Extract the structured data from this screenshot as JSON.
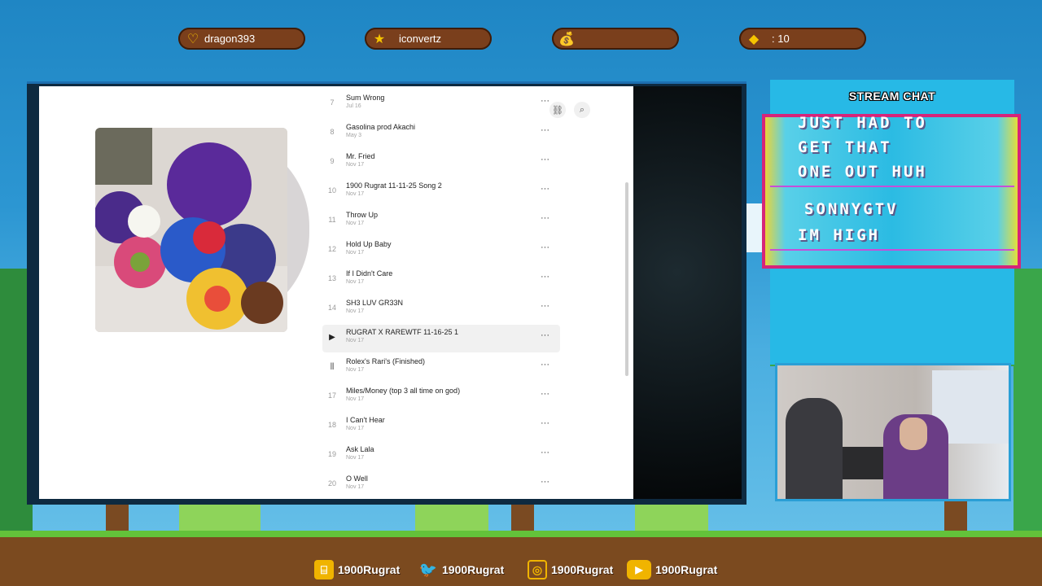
{
  "stats": [
    {
      "icon": "heart-icon",
      "glyph": "♡",
      "label": "dragon393"
    },
    {
      "icon": "star-icon",
      "glyph": "★",
      "label": "iconvertz"
    },
    {
      "icon": "money-bag-icon",
      "glyph": "💰",
      "label": ""
    },
    {
      "icon": "gem-icon",
      "glyph": "◆",
      "label": ": 10"
    }
  ],
  "chat": {
    "title": "STREAM CHAT",
    "lines": [
      "JUST HAD TO",
      "GET THAT",
      "ONE OUT HUH",
      "SONNYGTV",
      "IM HIGH"
    ]
  },
  "tracks": [
    {
      "num": "7",
      "title": "Sum Wrong",
      "date": "Jul 16"
    },
    {
      "num": "8",
      "title": "Gasolina prod Akachi",
      "date": "May 3"
    },
    {
      "num": "9",
      "title": "Mr. Fried",
      "date": "Nov 17"
    },
    {
      "num": "10",
      "title": "1900 Rugrat 11-11-25 Song 2",
      "date": "Nov 17"
    },
    {
      "num": "11",
      "title": "Throw Up",
      "date": "Nov 17"
    },
    {
      "num": "12",
      "title": "Hold Up Baby",
      "date": "Nov 17"
    },
    {
      "num": "13",
      "title": "If I Didn't Care",
      "date": "Nov 17"
    },
    {
      "num": "14",
      "title": "SH3 LUV GR33N",
      "date": "Nov 17"
    },
    {
      "num": "▶",
      "title": "RUGRAT X RAREWTF 11-16-25 1",
      "date": "Nov 17"
    },
    {
      "num": "⦀",
      "title": "Rolex's Rari's (Finished)",
      "date": "Nov 17"
    },
    {
      "num": "17",
      "title": "Miles/Money (top 3 all time on god)",
      "date": "Nov 17"
    },
    {
      "num": "18",
      "title": "I Can't Hear",
      "date": "Nov 17"
    },
    {
      "num": "19",
      "title": "Ask Lala",
      "date": "Nov 17"
    },
    {
      "num": "20",
      "title": "O Well",
      "date": "Nov 17"
    }
  ],
  "more_glyph": "···",
  "socials": [
    {
      "icon": "twitch-icon",
      "glyph": "⌸",
      "label": "1900Rugrat",
      "color": "#f0b400"
    },
    {
      "icon": "twitter-icon",
      "glyph": "🐦",
      "label": "1900Rugrat",
      "color": "#f0b400"
    },
    {
      "icon": "instagram-icon",
      "glyph": "◎",
      "label": "1900Rugrat",
      "color": "#f0b400"
    },
    {
      "icon": "youtube-icon",
      "glyph": "▶",
      "label": "1900Rugrat",
      "color": "#f0b400"
    }
  ]
}
